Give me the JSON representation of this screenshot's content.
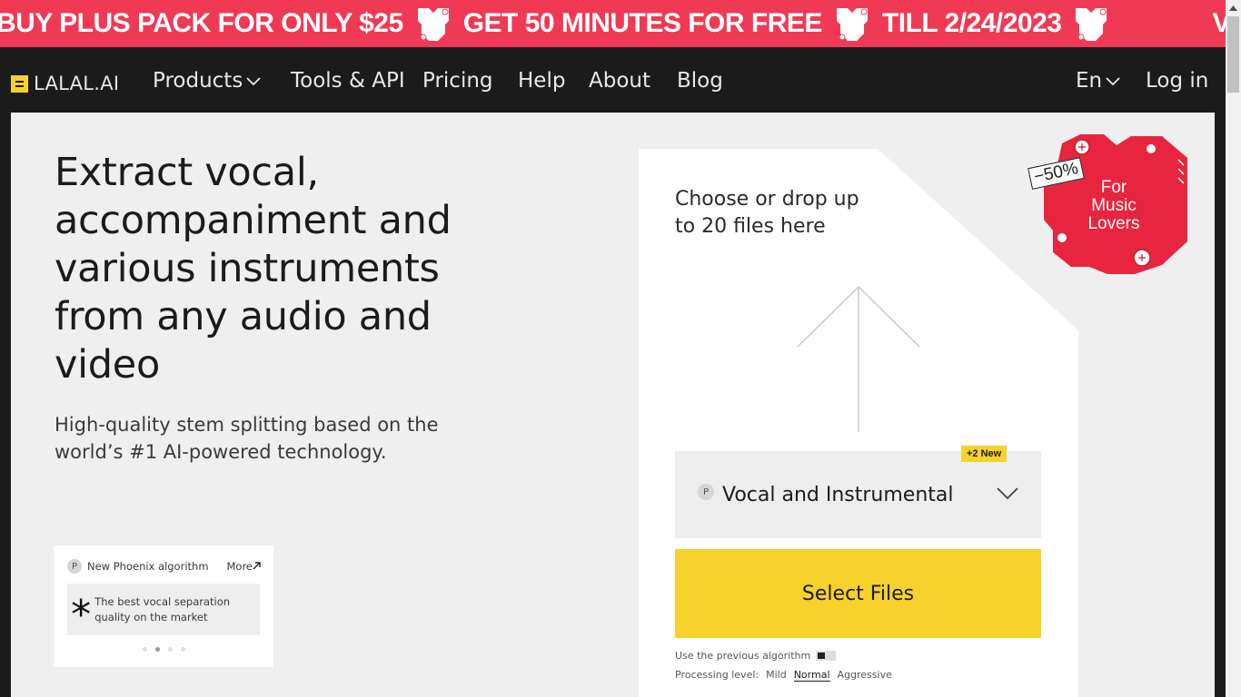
{
  "banner": {
    "segments": [
      "BUY PLUS PACK FOR ONLY $25",
      "GET 50 MINUTES FOR FREE",
      "TILL 2/24/2023",
      "VAL"
    ]
  },
  "nav": {
    "logo": "LALAL.AI",
    "items": [
      {
        "label": "Products",
        "dropdown": true
      },
      {
        "label": "Tools & API"
      },
      {
        "label": "Pricing"
      },
      {
        "label": "Help"
      },
      {
        "label": "About"
      },
      {
        "label": "Blog"
      }
    ],
    "language": "En",
    "login": "Log in"
  },
  "hero": {
    "title": "Extract vocal, accompaniment and various instruments from any audio and video",
    "subtitle": "High-quality stem splitting based on the world’s #1 AI-powered technology."
  },
  "algo_card": {
    "badge": "P",
    "title": "New Phoenix algorithm",
    "more": "More",
    "body": "The best vocal separation quality on the market",
    "dots": 4,
    "active_dot": 2
  },
  "upload": {
    "drop_text": "Choose or drop up to 20 files here",
    "model_badge": "P",
    "model": "Vocal and Instrumental",
    "new_badge": "+2 New",
    "select_button": "Select Files",
    "prev_algo_label": "Use the previous algorithm",
    "processing_label": "Processing level:",
    "levels": [
      "Mild",
      "Normal",
      "Aggressive"
    ],
    "active_level": "Normal"
  },
  "sticker": {
    "discount": "−50%",
    "text": "For Music Lovers"
  },
  "colors": {
    "banner": "#f03a55",
    "accent": "#f7d12c",
    "nav_bg": "#1c1b1c",
    "panel_bg": "#efefef"
  }
}
